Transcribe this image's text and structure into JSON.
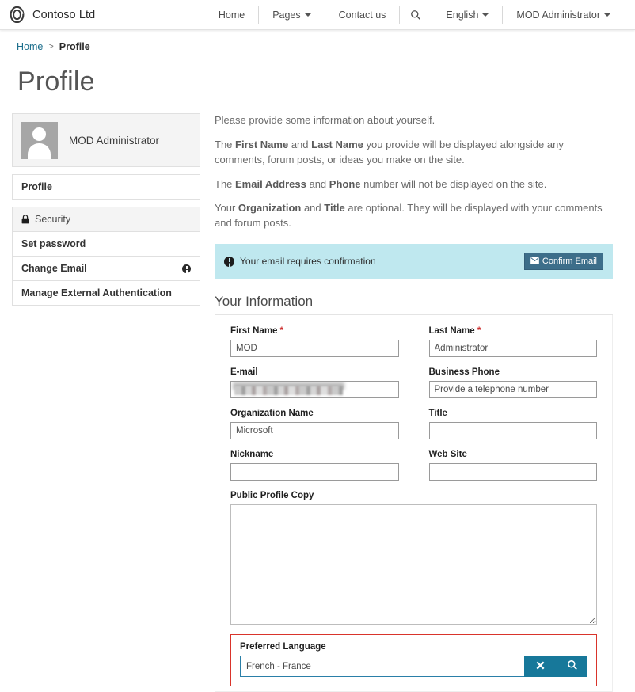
{
  "navbar": {
    "brand": "Contoso Ltd",
    "logo_icon": "contoso-ring-logo",
    "items": [
      {
        "label": "Home",
        "caret": false
      },
      {
        "label": "Pages",
        "caret": true
      },
      {
        "label": "Contact us",
        "caret": false
      }
    ],
    "search_icon": "search-icon",
    "language": {
      "label": "English",
      "caret": true
    },
    "account": {
      "label": "MOD Administrator",
      "caret": true
    }
  },
  "breadcrumb": {
    "home": "Home",
    "separator": ">",
    "current": "Profile"
  },
  "page": {
    "title": "Profile"
  },
  "sidebar": {
    "profile_card": {
      "name": "MOD Administrator",
      "avatar_icon": "user-avatar-placeholder"
    },
    "profile_link": "Profile",
    "security_header": {
      "label": "Security",
      "icon": "lock-icon"
    },
    "security_items": [
      {
        "label": "Set password",
        "badge": false
      },
      {
        "label": "Change Email",
        "badge": true,
        "badge_icon": "info-icon"
      },
      {
        "label": "Manage External Authentication",
        "badge": false
      }
    ]
  },
  "intro": {
    "p1": "Please provide some information about yourself.",
    "p2_a": "The ",
    "p2_b1": "First Name",
    "p2_c": " and ",
    "p2_b2": "Last Name",
    "p2_d": " you provide will be displayed alongside any comments, forum posts, or ideas you make on the site.",
    "p3_a": "The ",
    "p3_b1": "Email Address",
    "p3_c": " and ",
    "p3_b2": "Phone",
    "p3_d": " number will not be displayed on the site.",
    "p4_a": "Your ",
    "p4_b1": "Organization",
    "p4_c": " and ",
    "p4_b2": "Title",
    "p4_d": " are optional. They will be displayed with your comments and forum posts."
  },
  "alert": {
    "icon": "exclamation-circle-icon",
    "message": "Your email requires confirmation",
    "button_label": "Confirm Email",
    "button_icon": "envelope-icon",
    "background_color": "#bfe8ef",
    "button_color": "#3d6e8a"
  },
  "form": {
    "section_title": "Your Information",
    "required_marker": "*",
    "fields": {
      "first_name": {
        "label": "First Name",
        "required": true,
        "value": "MOD",
        "placeholder": ""
      },
      "last_name": {
        "label": "Last Name",
        "required": true,
        "value": "Administrator",
        "placeholder": ""
      },
      "email": {
        "label": "E-mail",
        "required": false,
        "value": "",
        "placeholder": "",
        "redacted": true
      },
      "business_phone": {
        "label": "Business Phone",
        "required": false,
        "value": "",
        "placeholder": "Provide a telephone number"
      },
      "organization_name": {
        "label": "Organization Name",
        "required": false,
        "value": "Microsoft",
        "placeholder": ""
      },
      "title": {
        "label": "Title",
        "required": false,
        "value": "",
        "placeholder": ""
      },
      "nickname": {
        "label": "Nickname",
        "required": false,
        "value": "",
        "placeholder": ""
      },
      "web_site": {
        "label": "Web Site",
        "required": false,
        "value": "",
        "placeholder": ""
      },
      "public_profile_copy": {
        "label": "Public Profile Copy",
        "required": false,
        "value": "",
        "placeholder": ""
      },
      "preferred_language": {
        "label": "Preferred Language",
        "value": "French - France",
        "placeholder": "",
        "clear_icon": "close-x-icon",
        "search_icon": "search-icon",
        "highlight_color": "#d9342b",
        "button_color": "#17789a"
      }
    }
  }
}
